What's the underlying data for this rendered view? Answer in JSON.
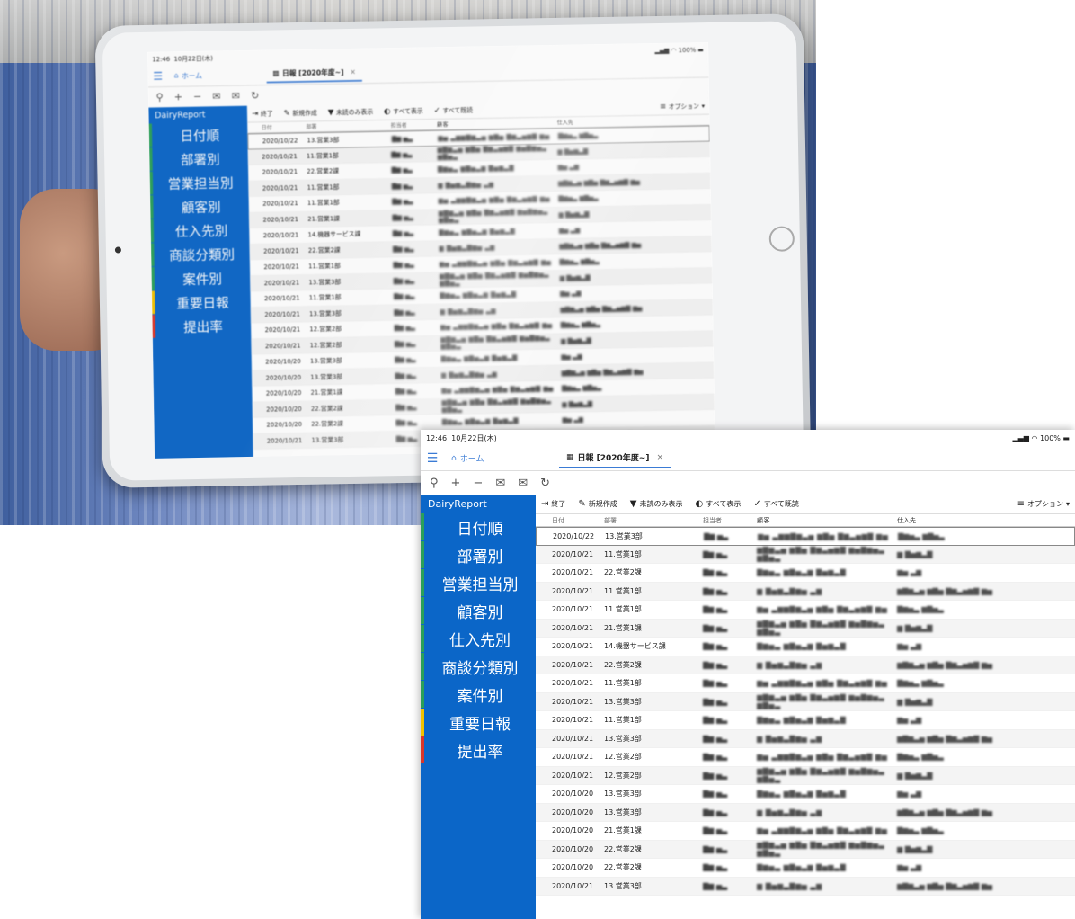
{
  "statusbar": {
    "time": "12:46",
    "date": "10月22日(木)",
    "right": "100%"
  },
  "tabs": {
    "home": "ホーム",
    "document": "日報 [2020年度~]",
    "close": "×"
  },
  "app_title": "DairyReport",
  "sidebar_items": [
    "日付順",
    "部署別",
    "営業担当別",
    "顧客別",
    "仕入先別",
    "商談分類別",
    "案件別",
    "重要日報",
    "提出率"
  ],
  "toolbar": {
    "exit": "終了",
    "new": "新規作成",
    "unread": "未読のみ表示",
    "show_all": "すべて表示",
    "all_read": "すべて既読",
    "options": "オプション"
  },
  "columns": [
    "日付",
    "部署",
    "担当者",
    "顧客",
    "仕入先"
  ],
  "rows": [
    {
      "date": "2020/10/22",
      "dept": "13.営業3部"
    },
    {
      "date": "2020/10/21",
      "dept": "11.営業1部"
    },
    {
      "date": "2020/10/21",
      "dept": "22.営業2課"
    },
    {
      "date": "2020/10/21",
      "dept": "11.営業1部"
    },
    {
      "date": "2020/10/21",
      "dept": "11.営業1部"
    },
    {
      "date": "2020/10/21",
      "dept": "21.営業1課"
    },
    {
      "date": "2020/10/21",
      "dept": "14.機器サービス課"
    },
    {
      "date": "2020/10/21",
      "dept": "22.営業2課"
    },
    {
      "date": "2020/10/21",
      "dept": "11.営業1部"
    },
    {
      "date": "2020/10/21",
      "dept": "13.営業3部"
    },
    {
      "date": "2020/10/21",
      "dept": "11.営業1部"
    },
    {
      "date": "2020/10/21",
      "dept": "13.営業3部"
    },
    {
      "date": "2020/10/21",
      "dept": "12.営業2部"
    },
    {
      "date": "2020/10/21",
      "dept": "12.営業2部"
    },
    {
      "date": "2020/10/20",
      "dept": "13.営業3部"
    },
    {
      "date": "2020/10/20",
      "dept": "13.営業3部"
    },
    {
      "date": "2020/10/20",
      "dept": "21.営業1課"
    },
    {
      "date": "2020/10/20",
      "dept": "22.営業2課"
    },
    {
      "date": "2020/10/20",
      "dept": "22.営業2課"
    },
    {
      "date": "2020/10/21",
      "dept": "13.営業3部"
    }
  ]
}
